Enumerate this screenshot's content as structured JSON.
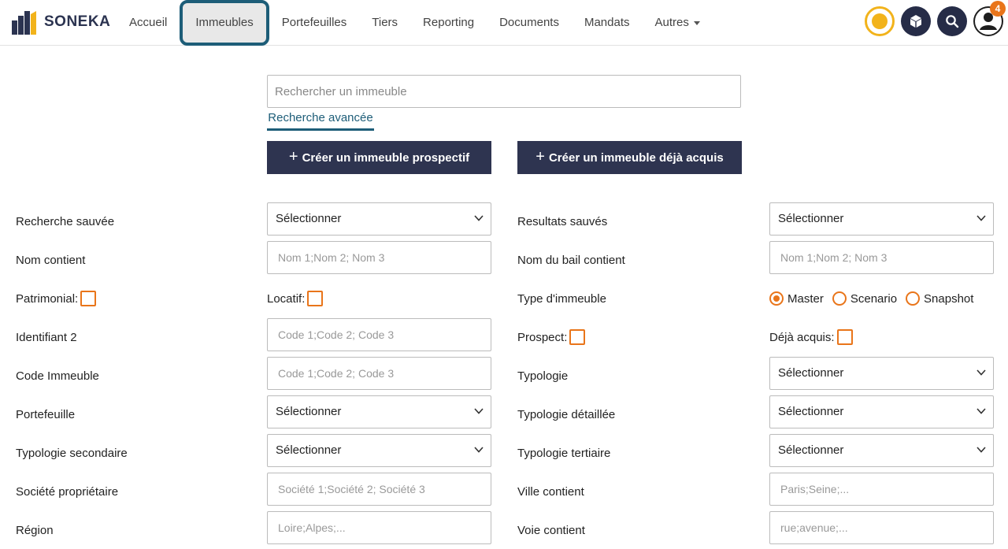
{
  "brand": {
    "name": "SONEKA"
  },
  "nav": {
    "items": [
      "Accueil",
      "Immeubles",
      "Portefeuilles",
      "Tiers",
      "Reporting",
      "Documents",
      "Mandats",
      "Autres"
    ],
    "active": "Immeubles"
  },
  "header": {
    "notification_count": "4",
    "status_color": "#f2b31b"
  },
  "search": {
    "placeholder": "Rechercher un immeuble",
    "advanced_link": "Recherche avancée"
  },
  "actions": {
    "create_prospective": "Créer un immeuble prospectif",
    "create_acquired": "Créer un immeuble déjà acquis"
  },
  "form": {
    "saved_search": {
      "label": "Recherche sauvée",
      "value": "Sélectionner"
    },
    "saved_results": {
      "label": "Resultats sauvés",
      "value": "Sélectionner"
    },
    "name_contains": {
      "label": "Nom contient",
      "placeholder": "Nom 1;Nom 2; Nom 3"
    },
    "lease_name_contains": {
      "label": "Nom du bail contient",
      "placeholder": "Nom 1;Nom 2; Nom 3"
    },
    "patrimonial": {
      "label": "Patrimonial:"
    },
    "locatif": {
      "label": "Locatif:"
    },
    "building_type": {
      "label": "Type d'immeuble",
      "options": [
        "Master",
        "Scenario",
        "Snapshot"
      ],
      "selected": "Master"
    },
    "identifier2": {
      "label": "Identifiant 2",
      "placeholder": "Code 1;Code 2; Code 3"
    },
    "prospect": {
      "label": "Prospect:"
    },
    "already_acquired": {
      "label": "Déjà acquis:"
    },
    "building_code": {
      "label": "Code Immeuble",
      "placeholder": "Code 1;Code 2; Code 3"
    },
    "typology": {
      "label": "Typologie",
      "value": "Sélectionner"
    },
    "portfolio": {
      "label": "Portefeuille",
      "value": "Sélectionner"
    },
    "detailed_typology": {
      "label": "Typologie détaillée",
      "value": "Sélectionner"
    },
    "secondary_typology": {
      "label": "Typologie secondaire",
      "value": "Sélectionner"
    },
    "tertiary_typology": {
      "label": "Typologie tertiaire",
      "value": "Sélectionner"
    },
    "owner_company": {
      "label": "Société propriétaire",
      "placeholder": "Société 1;Société 2; Société 3"
    },
    "city_contains": {
      "label": "Ville contient",
      "placeholder": "Paris;Seine;..."
    },
    "region": {
      "label": "Région",
      "placeholder": "Loire;Alpes;..."
    },
    "street_contains": {
      "label": "Voie contient",
      "placeholder": "rue;avenue;..."
    }
  },
  "colors": {
    "accent": "#e9751a",
    "navy": "#2e3450",
    "teal": "#1d5d78"
  }
}
